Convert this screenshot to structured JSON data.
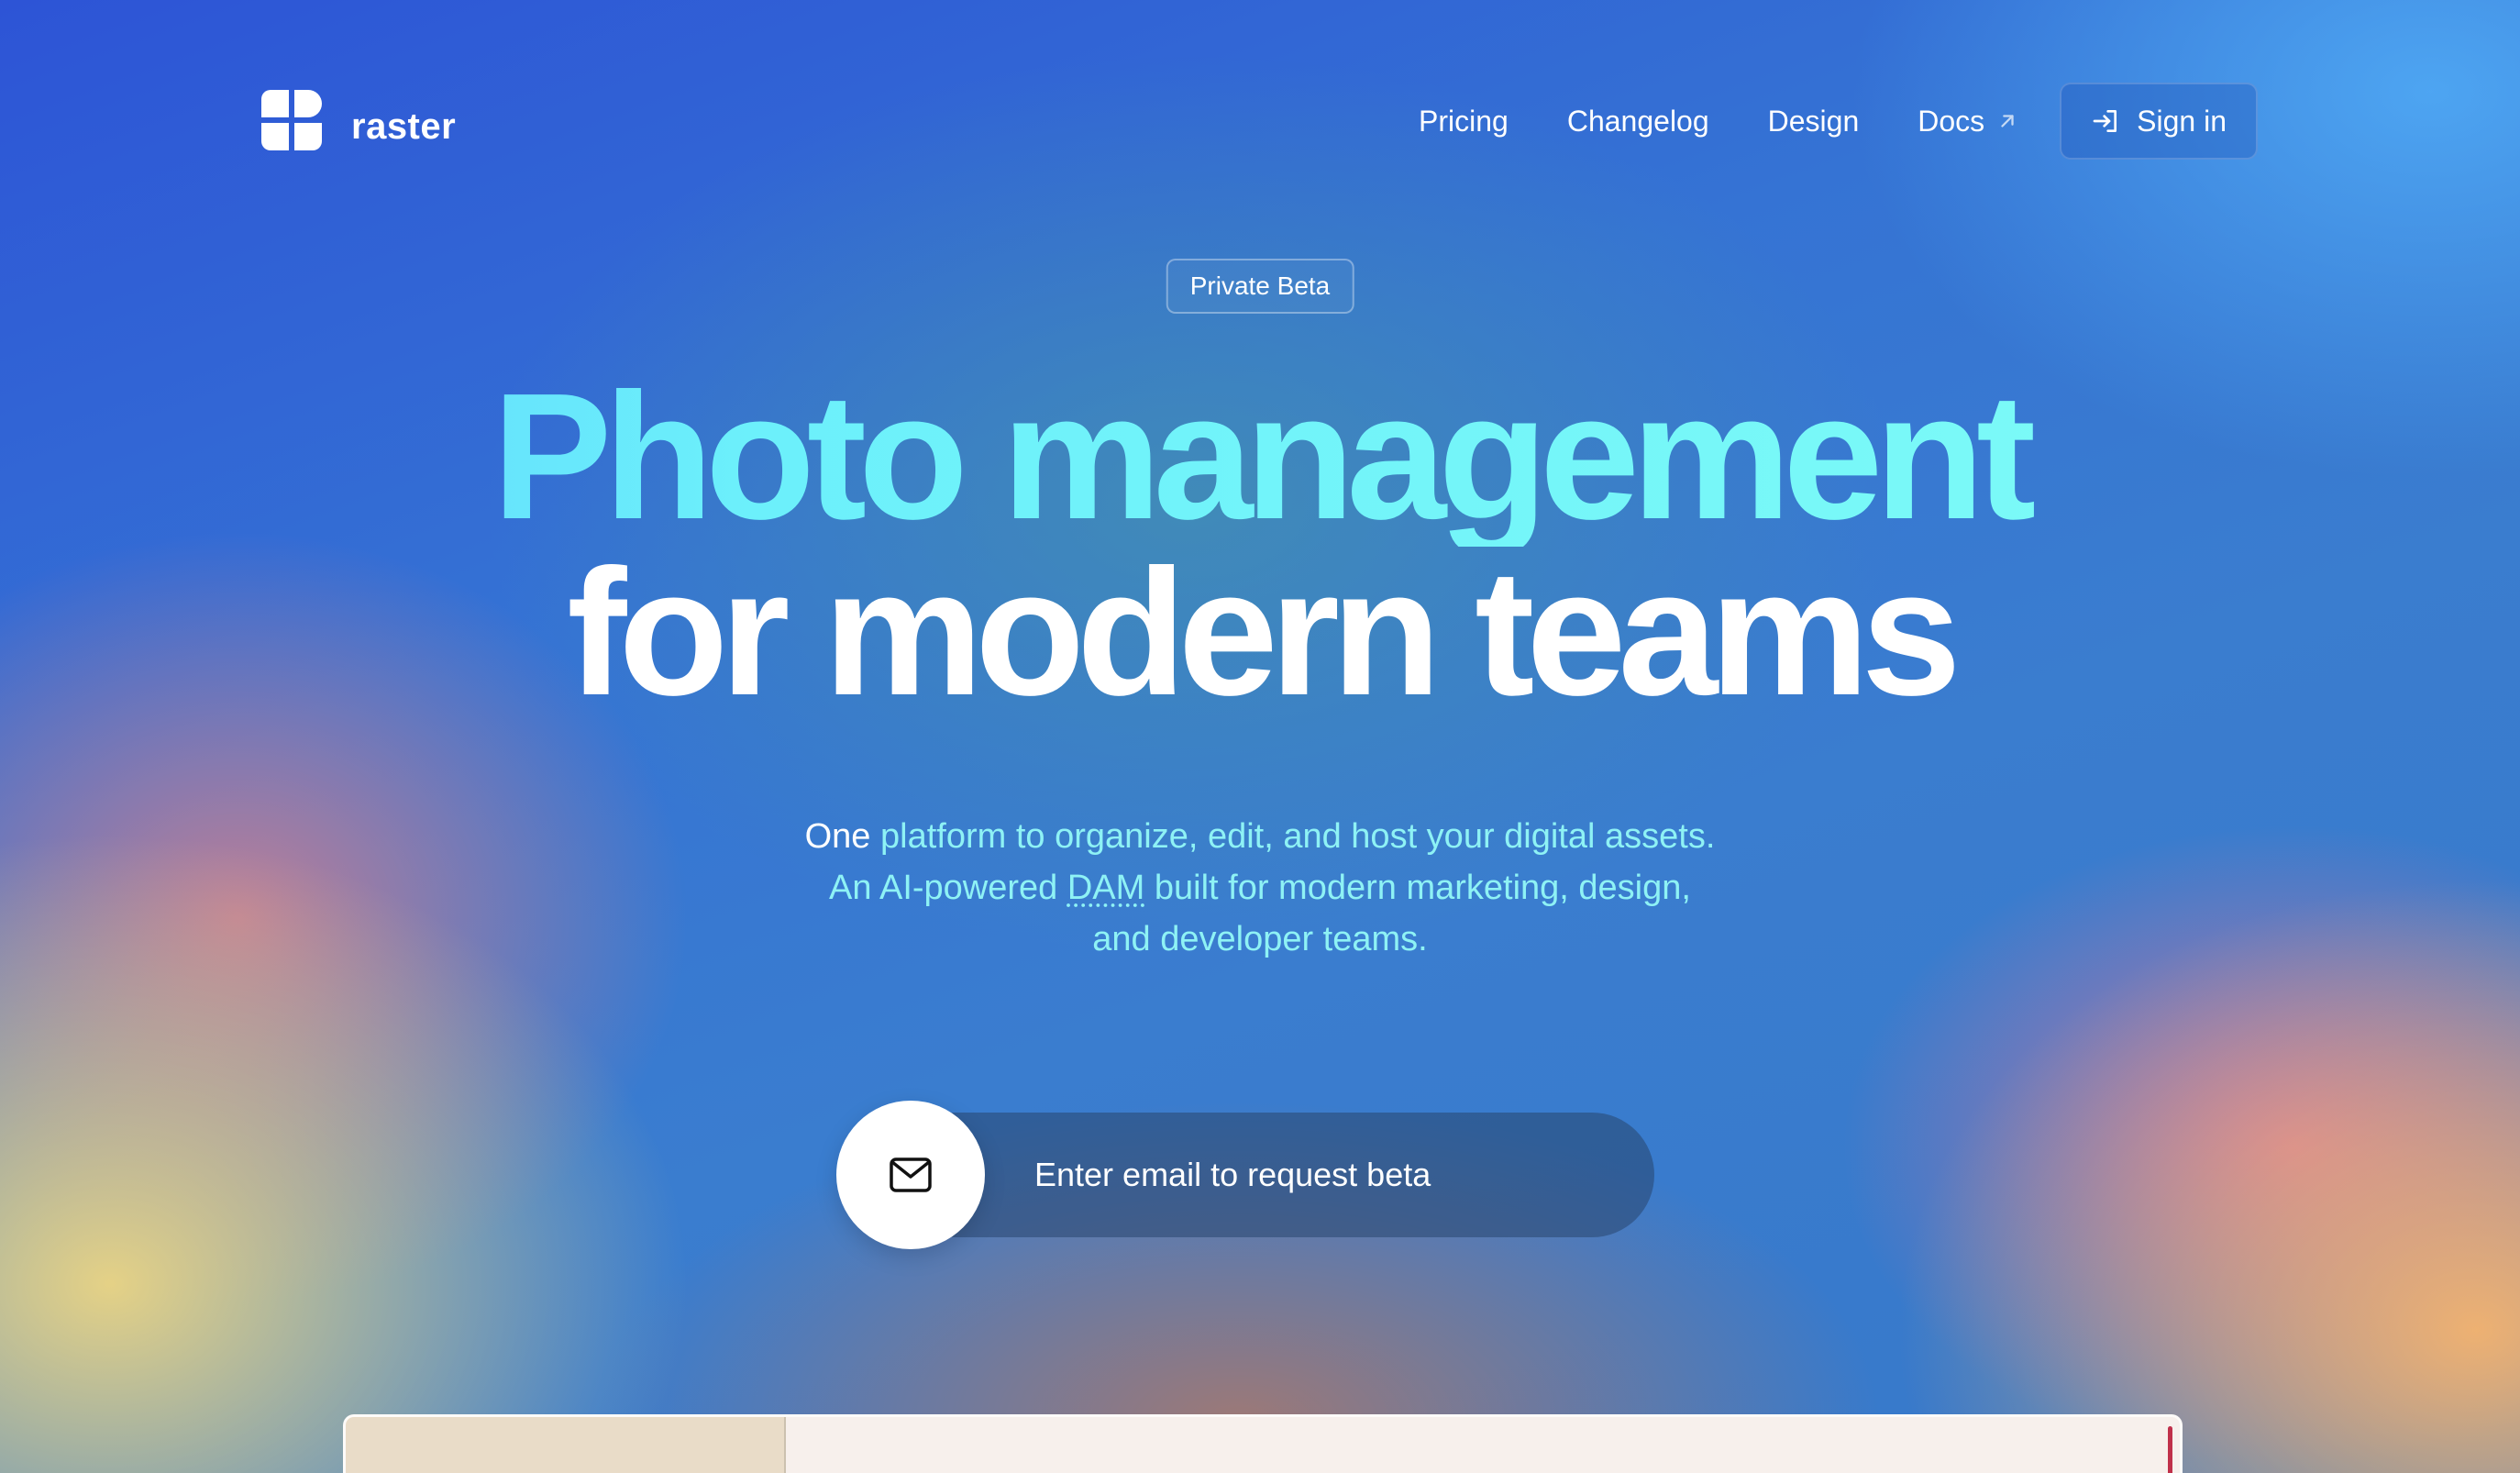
{
  "brand": {
    "name": "raster",
    "logo_icon": "raster-logo-icon"
  },
  "nav": {
    "items": [
      {
        "label": "Pricing"
      },
      {
        "label": "Changelog"
      },
      {
        "label": "Design"
      },
      {
        "label": "Docs",
        "icon": "external-link-arrow-icon"
      }
    ],
    "signin_label": "Sign in",
    "signin_icon": "sign-in-icon"
  },
  "hero": {
    "badge": "Private Beta",
    "headline_line1": "Photo management",
    "headline_line2": "for modern teams",
    "subtitle_part1": "One",
    "subtitle_part2": "platform to organize, edit, and host your digital assets. An AI-powered",
    "subtitle_dam": "DAM",
    "subtitle_part3": "built for modern marketing, design, and developer teams."
  },
  "signup": {
    "placeholder": "Enter email to request beta",
    "button_icon": "mail-icon"
  },
  "colors": {
    "headline_gradient_start": "#5ccffd",
    "headline_gradient_end": "#80fdf6",
    "subtitle": "#8ef2f5"
  }
}
